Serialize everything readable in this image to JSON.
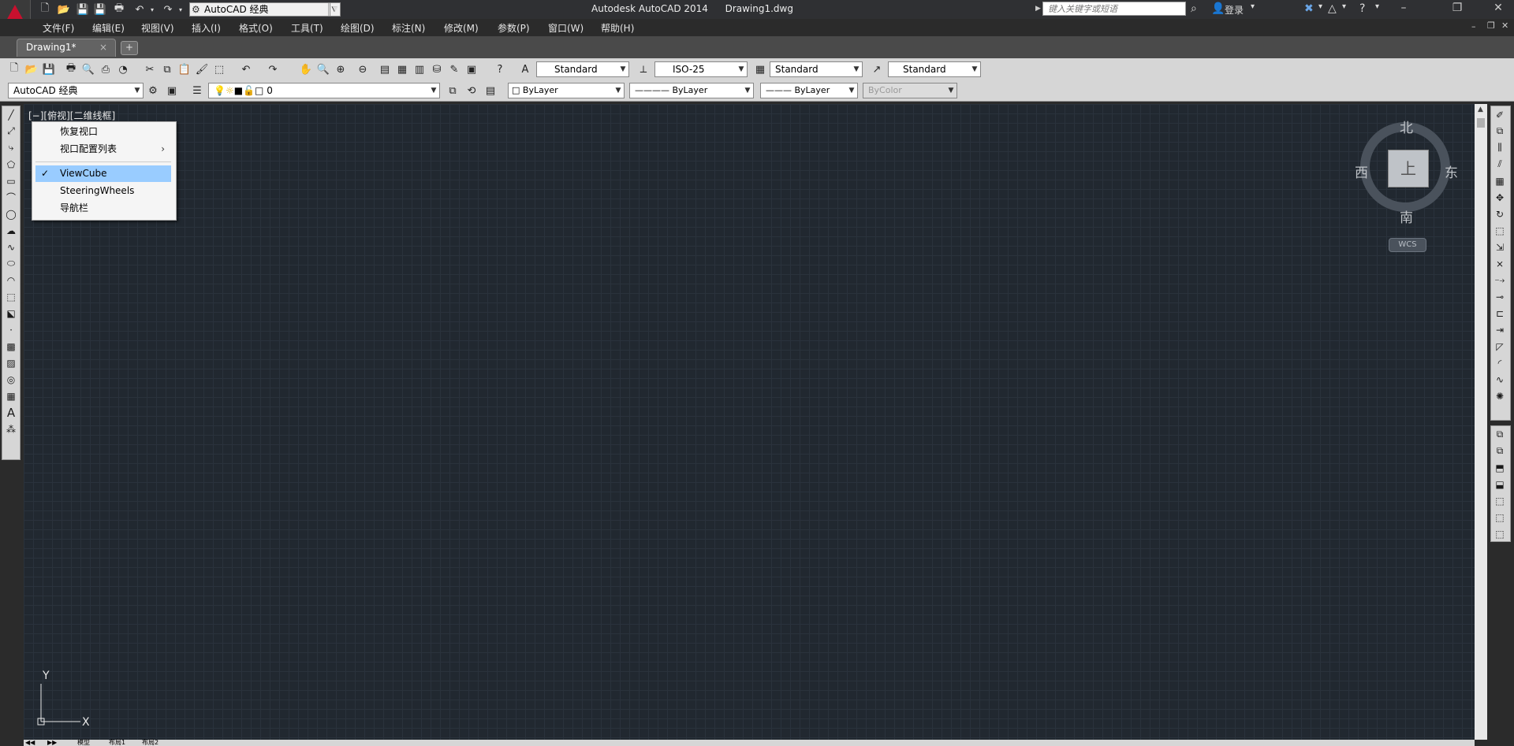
{
  "titlebar": {
    "app_title": "Autodesk AutoCAD 2014",
    "file_name": "Drawing1.dwg",
    "workspace": "AutoCAD 经典",
    "search_placeholder": "键入关键字或短语",
    "login_label": "登录"
  },
  "menu": [
    "文件(F)",
    "编辑(E)",
    "视图(V)",
    "插入(I)",
    "格式(O)",
    "工具(T)",
    "绘图(D)",
    "标注(N)",
    "修改(M)",
    "参数(P)",
    "窗口(W)",
    "帮助(H)"
  ],
  "tabs": {
    "active_doc": "Drawing1*",
    "close_glyph": "×"
  },
  "styles_toolbar": {
    "text_style": "Standard",
    "dim_style": "ISO-25",
    "table_style": "Standard",
    "mleader_style": "Standard"
  },
  "workspace_toolbar": {
    "workspace": "AutoCAD 经典",
    "layer": "0",
    "color": "ByLayer",
    "linetype": "———— ByLayer",
    "lineweight": "——— ByLayer",
    "plotstyle": "ByColor"
  },
  "viewport": {
    "label": "[−][俯视][二维线框]"
  },
  "context_menu": {
    "items": [
      {
        "label": "恢复视口",
        "checked": false,
        "submenu": false
      },
      {
        "label": "视口配置列表",
        "checked": false,
        "submenu": true
      },
      {
        "label": "ViewCube",
        "checked": true,
        "submenu": false,
        "selected": true
      },
      {
        "label": "SteeringWheels",
        "checked": false,
        "submenu": false
      },
      {
        "label": "导航栏",
        "checked": false,
        "submenu": false
      }
    ],
    "check_glyph": "✓",
    "submenu_glyph": "›"
  },
  "viewcube": {
    "north": "北",
    "south": "南",
    "east": "东",
    "west": "西",
    "face": "上",
    "wcs": "WCS"
  },
  "ucs": {
    "x_label": "X",
    "y_label": "Y"
  },
  "layout_tabs": [
    "模型",
    "布局1",
    "布局2"
  ],
  "colors": {
    "canvas_bg": "#212830",
    "menu_highlight": "#99ccff",
    "app_red": "#c8102e"
  }
}
